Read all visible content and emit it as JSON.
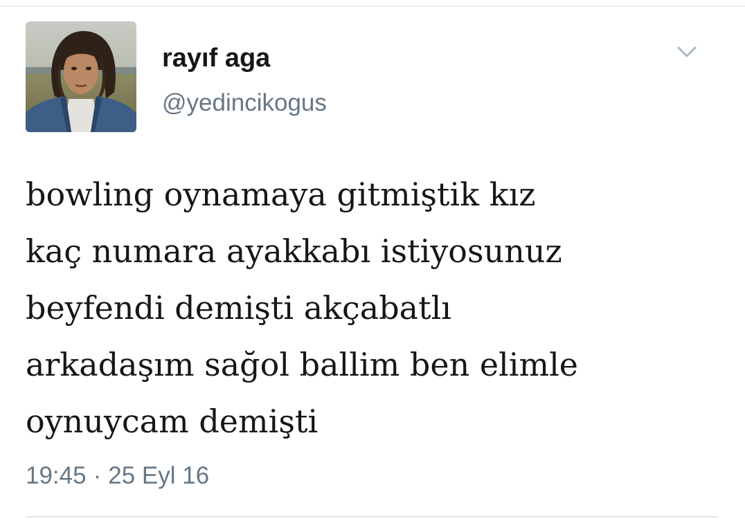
{
  "tweet": {
    "author": {
      "display_name": "rayıf aga",
      "handle": "@yedincikogus",
      "avatar_icon": "profile-photo"
    },
    "menu_icon": "chevron-down-icon",
    "text_lines": [
      "bowling oynamaya gitmiştik kız",
      "kaç numara ayakkabı istiyosunuz",
      "beyfendi demişti akçabatlı",
      "arkadaşım sağol ballim ben elimle",
      "oynuycam demişti"
    ],
    "time": "19:45",
    "separator": "·",
    "date": "25 Eyl 16"
  },
  "colors": {
    "text": "#14171a",
    "secondary": "#657786",
    "divider": "#e6ecf0",
    "chevron": "#aab8c2"
  }
}
